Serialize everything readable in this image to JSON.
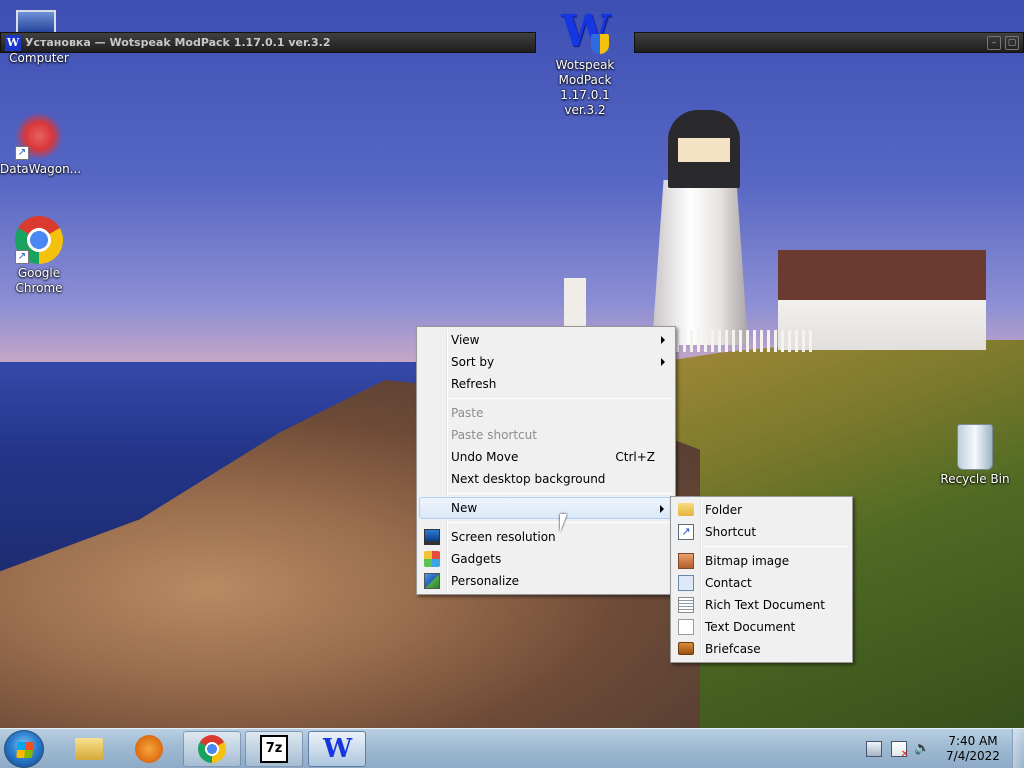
{
  "windows": {
    "setup_title": "Установка — Wotspeak ModPack 1.17.0.1 ver.3.2",
    "setup_icon": "W",
    "other_minimize": "–",
    "other_maximize": "▢"
  },
  "desktop_icons": {
    "my_computer": "My Computer",
    "datawagon": "DataWagon...",
    "chrome": "Google Chrome",
    "wotspeak": "Wotspeak ModPack 1.17.0.1 ver.3.2",
    "wotspeak_glyph": "W",
    "recycle_bin": "Recycle Bin",
    "shortcut_glyph": "↗"
  },
  "context_menu": {
    "view": "View",
    "sort_by": "Sort by",
    "refresh": "Refresh",
    "paste": "Paste",
    "paste_shortcut": "Paste shortcut",
    "undo_move": "Undo Move",
    "undo_move_shortcut": "Ctrl+Z",
    "next_background": "Next desktop background",
    "new": "New",
    "screen_resolution": "Screen resolution",
    "gadgets": "Gadgets",
    "personalize": "Personalize"
  },
  "new_submenu": {
    "folder": "Folder",
    "shortcut": "Shortcut",
    "bitmap": "Bitmap image",
    "contact": "Contact",
    "rtf": "Rich Text Document",
    "text": "Text Document",
    "briefcase": "Briefcase",
    "shortcut_glyph": "↗"
  },
  "taskbar": {
    "seven_zip_label": "7z",
    "wotspeak_label": "W",
    "volume_glyph": "🔊",
    "time": "7:40 AM",
    "date": "7/4/2022"
  },
  "colors": {
    "menu_bg": "#f0f0f0",
    "menu_hover": "#dbe8f7",
    "taskbar": "#9fbad2",
    "wotspeak_blue": "#1536e0"
  }
}
